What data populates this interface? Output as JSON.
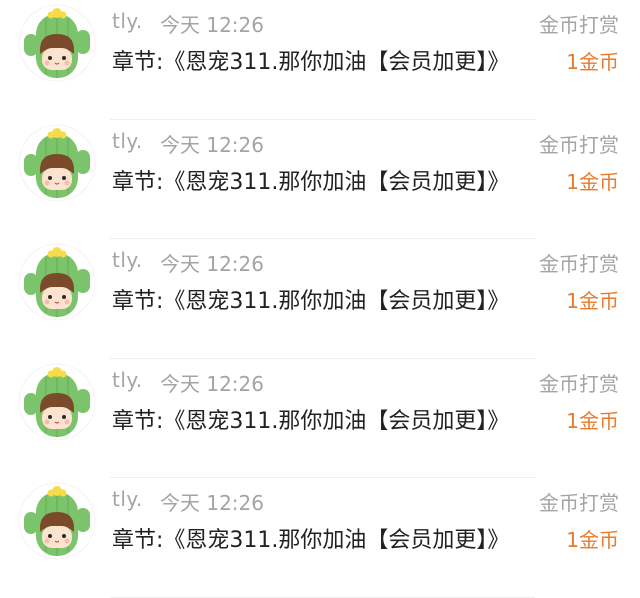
{
  "rewards": [
    {
      "username": "tly.",
      "time": "今天 12:26",
      "chapter": "章节:《恩宠311.那你加油【会员加更】》",
      "type": "金币打赏",
      "amount": "1金币"
    },
    {
      "username": "tly.",
      "time": "今天 12:26",
      "chapter": "章节:《恩宠311.那你加油【会员加更】》",
      "type": "金币打赏",
      "amount": "1金币"
    },
    {
      "username": "tly.",
      "time": "今天 12:26",
      "chapter": "章节:《恩宠311.那你加油【会员加更】》",
      "type": "金币打赏",
      "amount": "1金币"
    },
    {
      "username": "tly.",
      "time": "今天 12:26",
      "chapter": "章节:《恩宠311.那你加油【会员加更】》",
      "type": "金币打赏",
      "amount": "1金币"
    },
    {
      "username": "tly.",
      "time": "今天 12:26",
      "chapter": "章节:《恩宠311.那你加油【会员加更】》",
      "type": "金币打赏",
      "amount": "1金币"
    }
  ],
  "avatar_icon": "cactus-boy-avatar",
  "colors": {
    "muted_text": "#a4a4a4",
    "primary_text": "#222222",
    "accent_orange": "#e87b2d",
    "cactus_green": "#7cc46b"
  }
}
